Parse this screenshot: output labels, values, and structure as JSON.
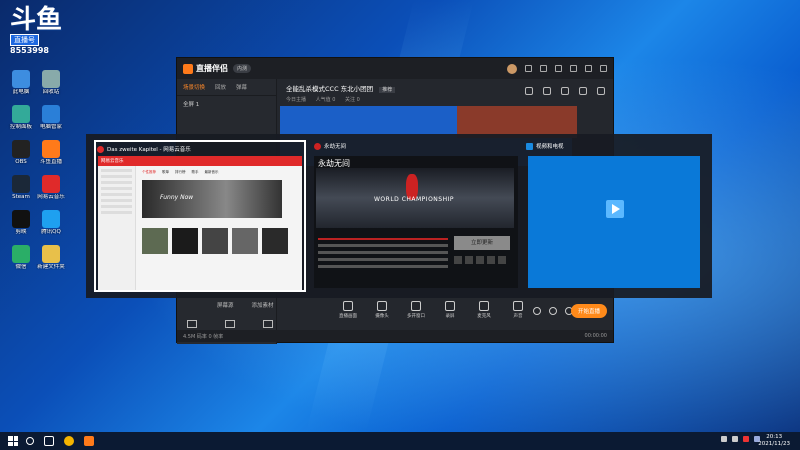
{
  "desktop": {
    "brand": {
      "big": "斗鱼",
      "tag": "直播号",
      "number": "8553998"
    },
    "icons": [
      {
        "label": "此电脑",
        "color": "#3d8de0"
      },
      {
        "label": "回收站",
        "color": "#8aa"
      },
      {
        "label": "控制面板",
        "color": "#3a9"
      },
      {
        "label": "电脑管家",
        "color": "#2a7fd8"
      },
      {
        "label": "OBS",
        "color": "#222"
      },
      {
        "label": "斗鱼直播",
        "color": "#ff7a1a"
      },
      {
        "label": "Steam",
        "color": "#1b2838"
      },
      {
        "label": "网易云音乐",
        "color": "#e02a2a"
      },
      {
        "label": "剪映",
        "color": "#111"
      },
      {
        "label": "腾讯QQ",
        "color": "#1ea0f0"
      },
      {
        "label": "微信",
        "color": "#2aae67"
      },
      {
        "label": "新建文件夹",
        "color": "#e8c04a"
      }
    ]
  },
  "app": {
    "name": "直播伴侣",
    "version": "内测",
    "left_tabs": [
      "场景切换",
      "回放",
      "弹幕"
    ],
    "left_row": "全屏 1",
    "room_title": "全能乱杀模式CCC 东北小团团",
    "room_tag": "推荐",
    "room_sub": [
      "今日主播",
      "人气值 0",
      "关注 0"
    ],
    "bottom_tabs": [
      "屏幕源",
      "添加素材"
    ],
    "tools": [
      "直播画面",
      "摄像头",
      "多开窗口",
      "录屏",
      "麦克风",
      "声音"
    ],
    "live_button": "开始直播",
    "status_left": "4.5M 码率 0 帧率",
    "status_right": "00:00:00"
  },
  "alttab": {
    "windows": [
      {
        "title": "Das zweite Kapitel - 网易云音乐",
        "icon_color": "#e02a2a",
        "app_header": "网易云音乐",
        "tabs": [
          "个性推荐",
          "歌单",
          "排行榜",
          "歌手",
          "最新音乐"
        ],
        "banner_text": "Funny Now"
      },
      {
        "title": "永劫无间",
        "icon_color": "#c22",
        "game_logo": "永劫无间",
        "hero_text": "WORLD CHAMPIONSHIP",
        "enter_label": "立即更新"
      },
      {
        "title": "视频和电视",
        "icon_color": "#1a8ae0"
      }
    ]
  },
  "taskbar": {
    "time": "20:13",
    "date": "2021/11/23",
    "tray_icons": [
      "network-icon",
      "volume-icon",
      "chinese-input-icon"
    ]
  }
}
